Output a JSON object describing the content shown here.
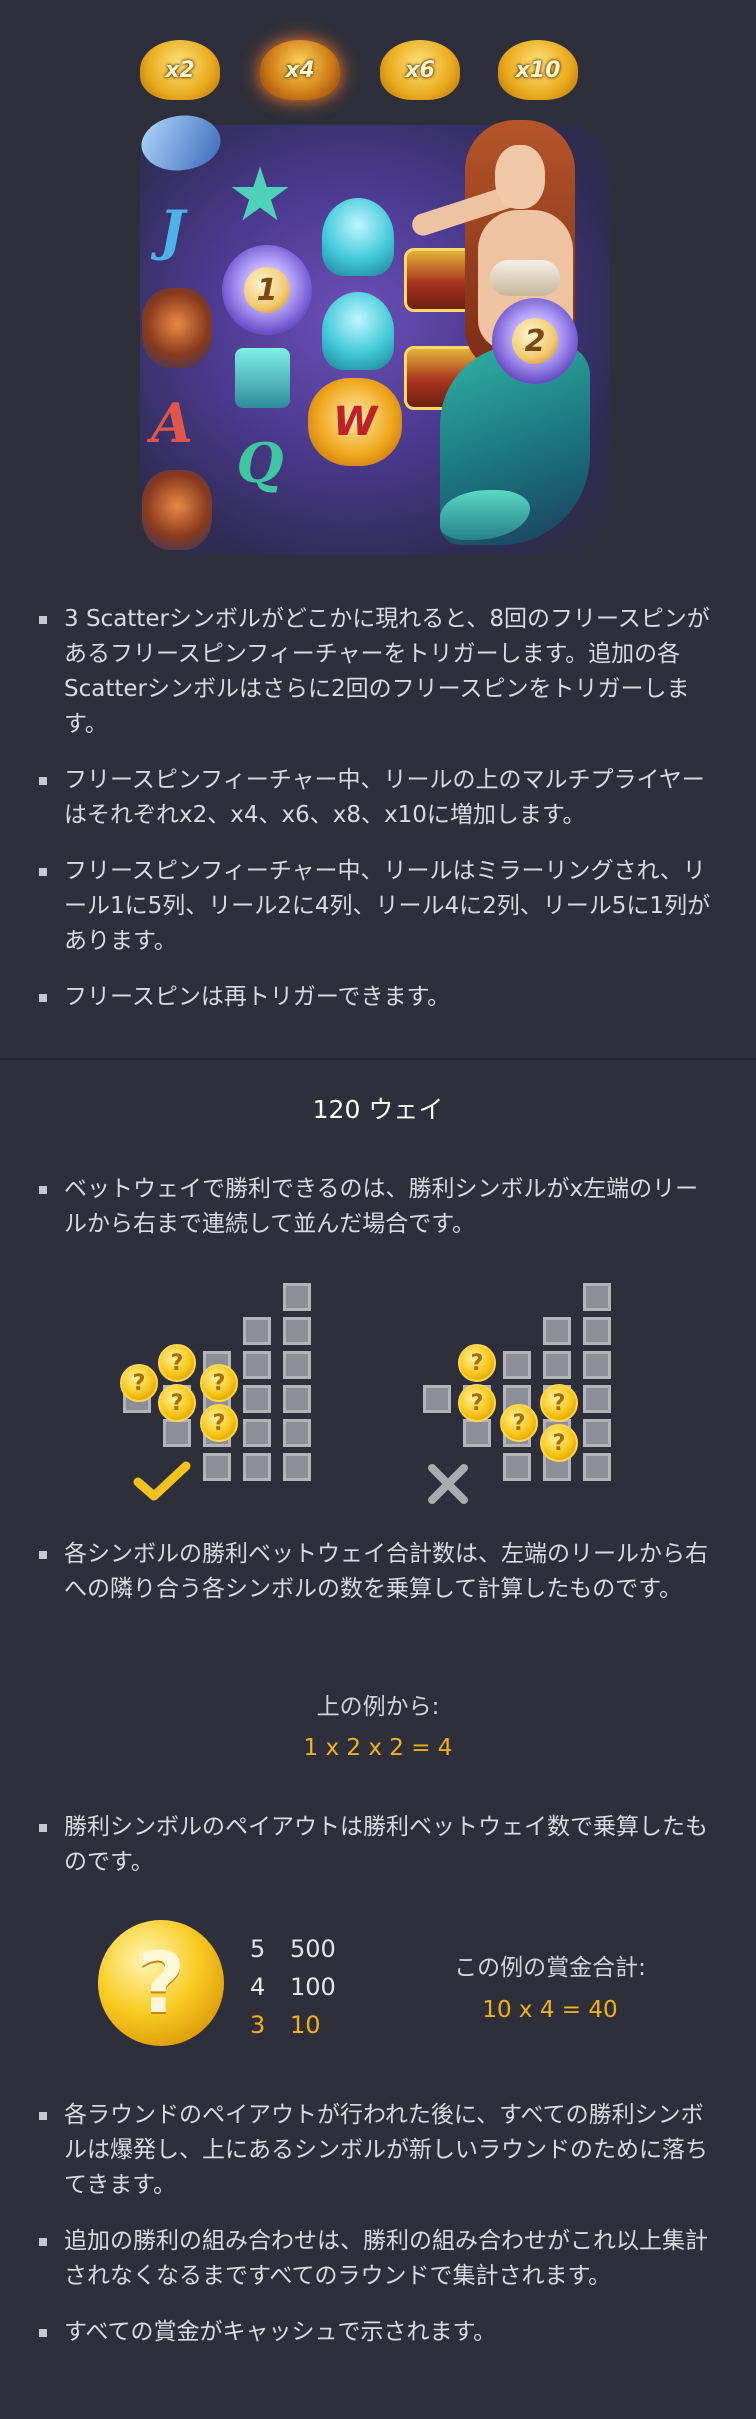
{
  "multipliers": [
    "x2",
    "x4",
    "x6",
    "x10"
  ],
  "active_multiplier_index": 1,
  "reel_symbols": {
    "scatter_1": "1",
    "scatter_2": "2",
    "wild": "W",
    "letters": [
      "J",
      "A",
      "Q"
    ]
  },
  "free_spins_bullets": [
    "3 Scatterシンボルがどこかに現れると、8回のフリースピンがあるフリースピンフィーチャーをトリガーします。追加の各Scatterシンボルはさらに2回のフリースピンをトリガーします。",
    "フリースピンフィーチャー中、リールの上のマルチプライヤーはそれぞれx2、x4、x6、x8、x10に増加します。",
    "フリースピンフィーチャー中、リールはミラーリングされ、リール1に5列、リール2に4列、リール4に2列、リール5に1列があります。",
    "フリースピンは再トリガーできます。"
  ],
  "ways_section": {
    "title": "120 ウェイ",
    "bullet_1": "ベットウェイで勝利できるのは、勝利シンボルがx左端のリールから右まで連続して並んだ場合です。",
    "bullet_2": "各シンボルの勝利ベットウェイ合計数は、左端のリールから右への隣り合う各シンボルの数を乗算して計算したものです。",
    "example_label": "上の例から:",
    "example_formula": "1 x 2 x 2 = 4",
    "bullet_3": "勝利シンボルのペイアウトは勝利ベットウェイ数で乗算したものです。"
  },
  "payout_example": {
    "symbol_glyph": "?",
    "table": [
      {
        "count": "5",
        "payout": "500",
        "highlight": false
      },
      {
        "count": "4",
        "payout": "100",
        "highlight": false
      },
      {
        "count": "3",
        "payout": "10",
        "highlight": true
      }
    ],
    "prize_label": "この例の賞金合計:",
    "prize_formula": "10 x 4 = 40"
  },
  "cascade_bullets": [
    "各ラウンドのペイアウトが行われた後に、すべての勝利シンボルは爆発し、上にあるシンボルが新しいラウンドのために落ちてきます。",
    "追加の勝利の組み合わせは、勝利の組み合わせがこれ以上集計されなくなるまですべてのラウンドで集計されます。",
    "すべての賞金がキャッシュで示されます。"
  ],
  "coin_glyph": "?",
  "colors": {
    "background": "#2e2f3a",
    "accent_gold": "#f0b21b",
    "text": "#d9d9e2",
    "grid_cell": "#8e8e98",
    "check": "#f3c21e",
    "cross": "#a9a9b2"
  }
}
